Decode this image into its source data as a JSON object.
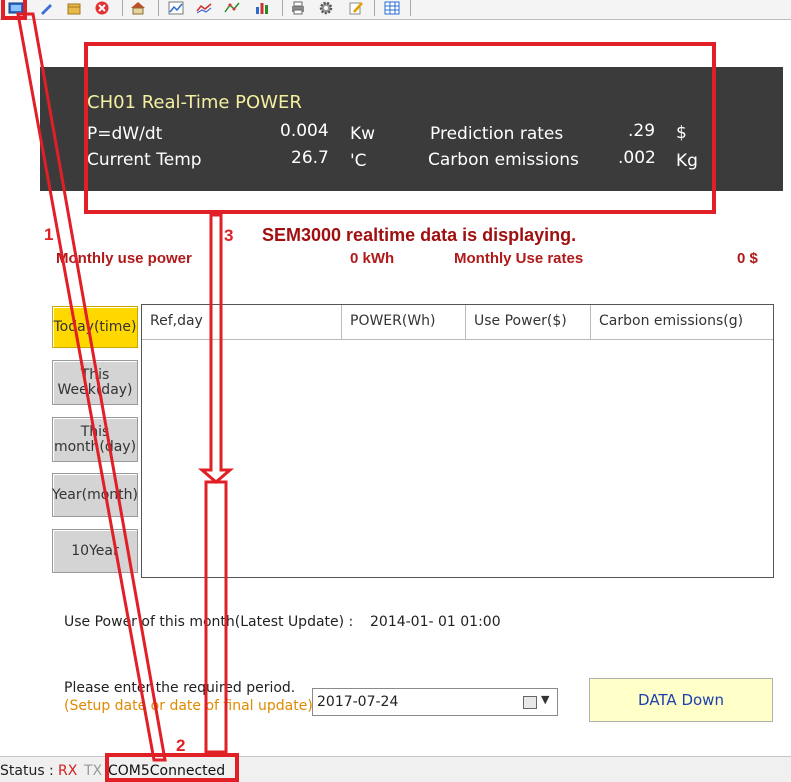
{
  "toolbar": {
    "icons": [
      "monitor-icon",
      "wrench-icon",
      "package-icon",
      "close-icon",
      "home-icon",
      "chart-icon",
      "line-chart-icon",
      "scatter-chart-icon",
      "bar-chart-icon",
      "print-icon",
      "gear-icon",
      "edit-icon",
      "table-icon"
    ]
  },
  "realtime": {
    "title": "CH01   Real-Time POWER",
    "power_label": "P=dW/dt",
    "power_value": "0.004",
    "power_unit": "Kw",
    "temp_label": "Current Temp",
    "temp_value": "26.7",
    "temp_unit": "'C",
    "prediction_label": "Prediction rates",
    "prediction_value": ".29",
    "prediction_unit": "$",
    "carbon_label": "Carbon emissions",
    "carbon_value": ".002",
    "carbon_unit": "Kg"
  },
  "monthly": {
    "use_power_label": "Monthly use power",
    "use_power_value": "0 kWh",
    "use_rates_label": "Monthly Use rates",
    "use_rates_value": "0 $"
  },
  "nav": [
    {
      "label": "Today(time)",
      "active": true
    },
    {
      "label": "This Week(day)",
      "active": false
    },
    {
      "label": "This month(day)",
      "active": false
    },
    {
      "label": "Year(month)",
      "active": false
    },
    {
      "label": "10Year",
      "active": false
    }
  ],
  "table": {
    "columns": [
      "Ref,day",
      "POWER(Wh)",
      "Use Power($)",
      "Carbon emissions(g)"
    ],
    "rows": []
  },
  "latest": {
    "label": "Use Power of this month(Latest Update) :",
    "value": "2014-01- 01 01:00"
  },
  "period": {
    "label": "Please enter the required period.",
    "hint": "(Setup date or date of final update)",
    "date_value": "2017-07-24",
    "button_label": "DATA Down"
  },
  "status": {
    "label": "Status :",
    "rx": "RX",
    "tx": "TX",
    "connection": "COM5Connected"
  },
  "annotations": {
    "n1": "1",
    "n2": "2",
    "n3": "3",
    "message": "SEM3000 realtime data is displaying."
  },
  "colors": {
    "annotation": "#e01f26",
    "panel_bg": "#3b3b3b",
    "active_nav": "#ffd800",
    "monthly_text": "#b01a1a"
  }
}
